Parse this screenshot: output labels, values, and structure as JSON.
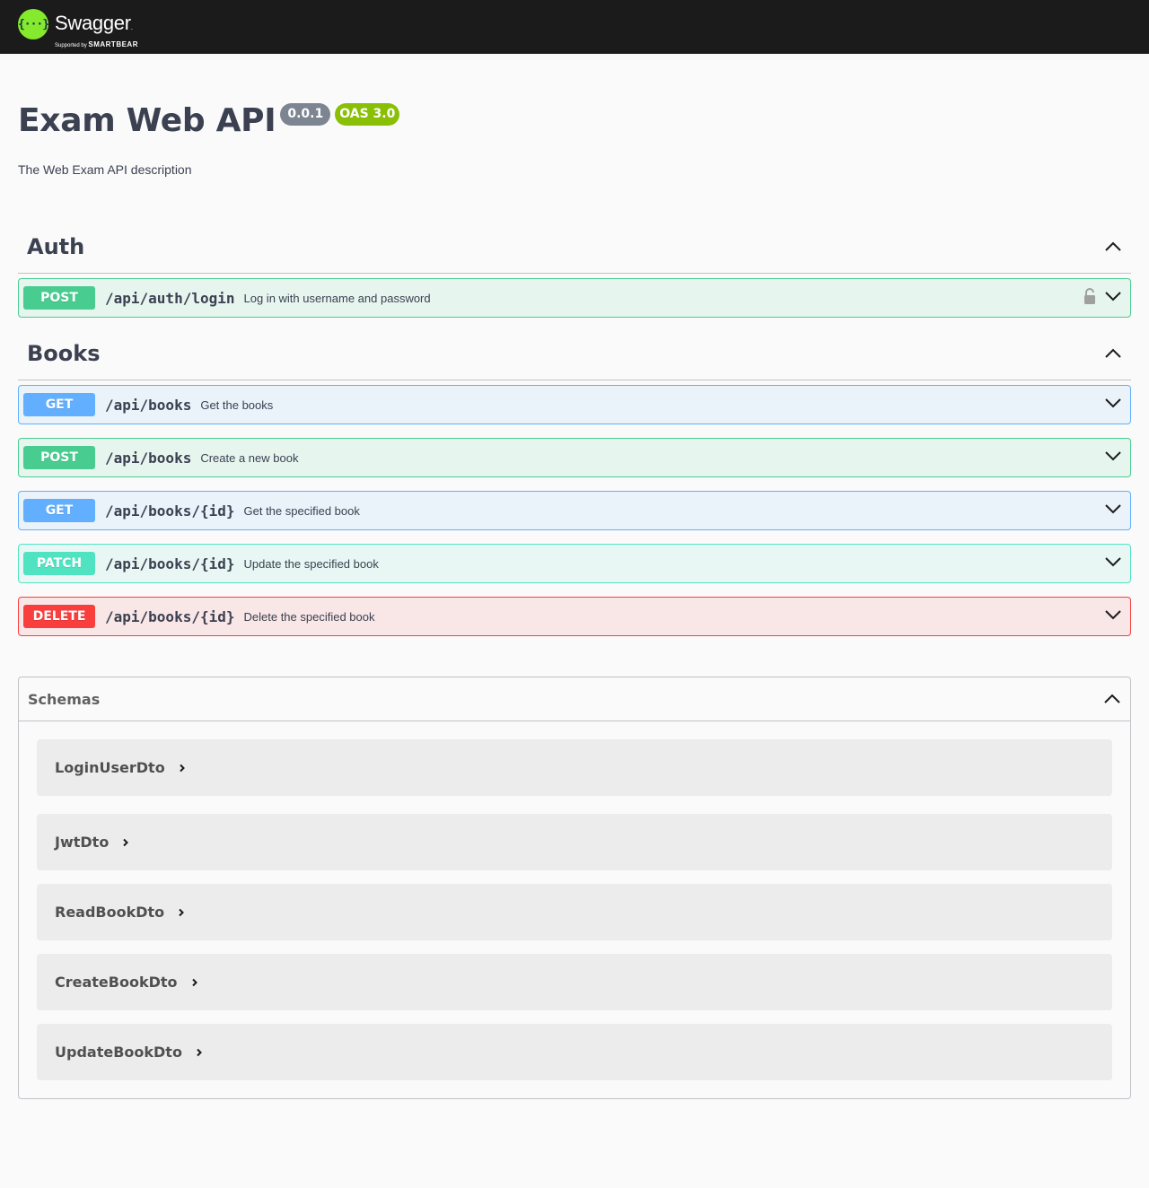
{
  "topbar": {
    "logo_mark": "{···}",
    "logo_name": "Swagger",
    "logo_tm": ".",
    "logo_sub_prefix": "Supported by",
    "logo_sub_brand": "SMARTBEAR"
  },
  "info": {
    "title": "Exam Web API",
    "version": "0.0.1",
    "oas": "OAS 3.0",
    "description": "The Web Exam API description"
  },
  "tags": [
    {
      "name": "Auth",
      "operations": [
        {
          "method": "POST",
          "path": "/api/auth/login",
          "summary": "Log in with username and password",
          "locked": true
        }
      ]
    },
    {
      "name": "Books",
      "operations": [
        {
          "method": "GET",
          "path": "/api/books",
          "summary": "Get the books"
        },
        {
          "method": "POST",
          "path": "/api/books",
          "summary": "Create a new book"
        },
        {
          "method": "GET",
          "path": "/api/books/{id}",
          "summary": "Get the specified book"
        },
        {
          "method": "PATCH",
          "path": "/api/books/{id}",
          "summary": "Update the specified book"
        },
        {
          "method": "DELETE",
          "path": "/api/books/{id}",
          "summary": "Delete the specified book"
        }
      ]
    }
  ],
  "schemas": {
    "title": "Schemas",
    "models": [
      "LoginUserDto",
      "JwtDto",
      "ReadBookDto",
      "CreateBookDto",
      "UpdateBookDto"
    ]
  },
  "colors": {
    "topbar": "#1b1b1b",
    "logo_green": "#85ea2d",
    "post": "#49cc90",
    "get": "#61affe",
    "patch": "#50e3c2",
    "delete": "#f93e3e",
    "version_badge": "#7d8492",
    "oas_badge": "#89bf04"
  }
}
